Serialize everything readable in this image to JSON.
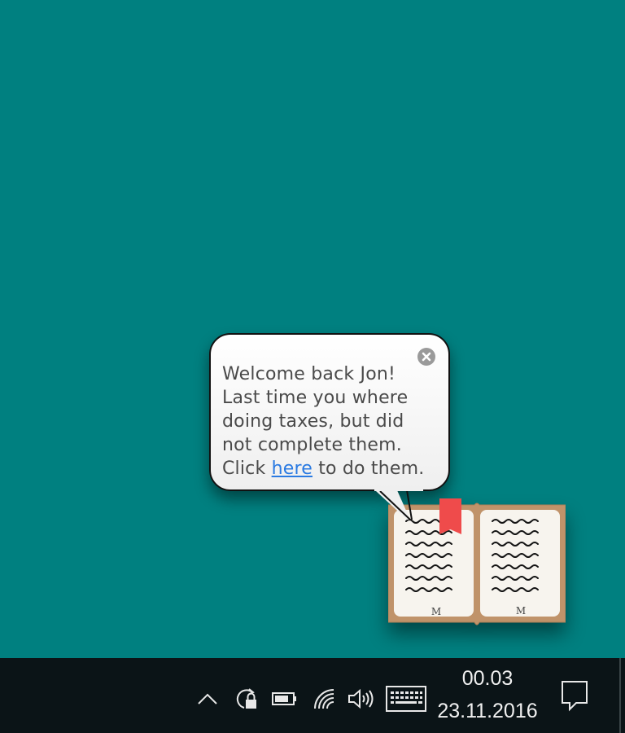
{
  "bubble": {
    "line1": "Welcome back Jon!",
    "line2": "Last time you where",
    "line3": "doing taxes, but did",
    "line4": "not complete them.",
    "line5_before": "Click ",
    "link_text": "here",
    "line5_after": " to do them."
  },
  "book": {
    "left_page_mark": "M",
    "right_page_mark": "M",
    "bookmark_color": "#ef4b4b"
  },
  "taskbar": {
    "time": "00.03",
    "date": "23.11.2016",
    "icons": [
      "chevron-up-icon",
      "lock-update-icon",
      "battery-icon",
      "wifi-icon",
      "volume-icon",
      "keyboard-icon",
      "notification-icon"
    ]
  },
  "colors": {
    "desktop": "#008080",
    "taskbar": "#0b1417",
    "link": "#2a7ae2"
  }
}
